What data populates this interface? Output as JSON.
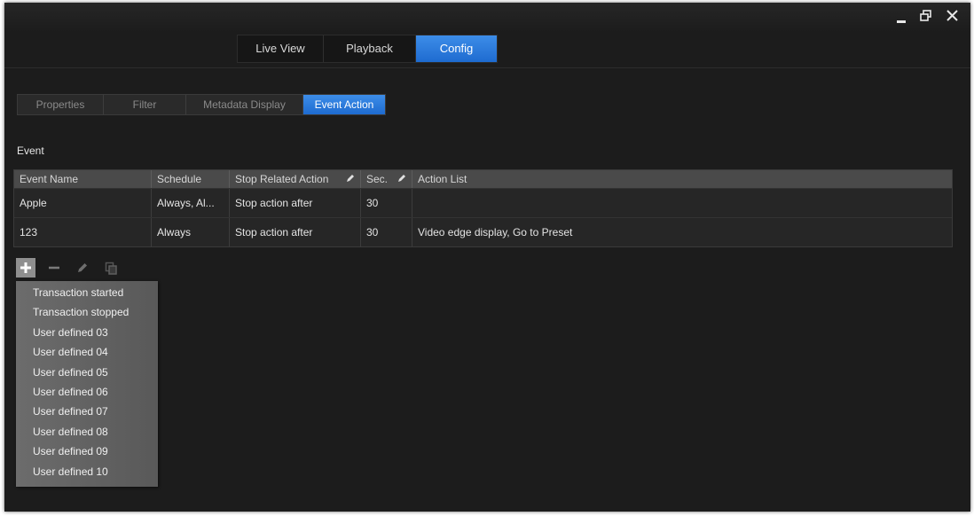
{
  "window_controls": {
    "restore_glyph": "restore",
    "close_glyph": "close"
  },
  "main_tabs": [
    {
      "label": "Live View"
    },
    {
      "label": "Playback"
    },
    {
      "label": "Config"
    }
  ],
  "main_tabs_active": "Config",
  "sub_tabs": [
    {
      "label": "Properties"
    },
    {
      "label": "Filter"
    },
    {
      "label": "Metadata Display"
    },
    {
      "label": "Event Action"
    }
  ],
  "sub_tabs_active": "Event Action",
  "section": {
    "title": "Event"
  },
  "table": {
    "headers": [
      "Event Name",
      "Schedule",
      "Stop Related Action",
      "Sec.",
      "Action List"
    ],
    "rows": [
      [
        "Apple",
        "Always, Al...",
        "Stop action after",
        "30",
        ""
      ],
      [
        "123",
        "Always",
        "Stop action after",
        "30",
        "Video edge display, Go to Preset"
      ]
    ]
  },
  "toolbar": {
    "icons": [
      "plus-icon",
      "minus-icon",
      "pencil-icon",
      "copy-icon"
    ]
  },
  "dropdown": {
    "items": [
      "Transaction started",
      "Transaction stopped",
      "User defined 03",
      "User defined 04",
      "User defined 05",
      "User defined 06",
      "User defined 07",
      "User defined 08",
      "User defined 09",
      "User defined 10"
    ]
  },
  "colors": {
    "accent": "#2a7ae0",
    "window_bg": "#1c1c1c",
    "header_bg": "#4a4a4a",
    "dropdown_bg": "#636363"
  }
}
